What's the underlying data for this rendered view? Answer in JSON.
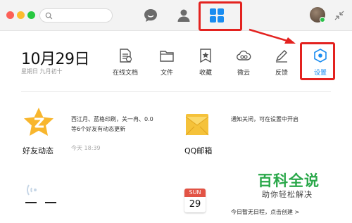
{
  "topbar": {
    "icons": [
      "search-icon",
      "chat-icon",
      "contacts-icon",
      "apps-grid-icon",
      "avatar",
      "collapse-icon"
    ],
    "accent": "#1a8cf0",
    "highlight_color": "#e3221f"
  },
  "header": {
    "date": "10月29日",
    "lunar": "星期日  九月初十"
  },
  "tools": [
    {
      "label": "在线文档",
      "icon": "online-doc-icon"
    },
    {
      "label": "文件",
      "icon": "folder-icon"
    },
    {
      "label": "收藏",
      "icon": "favorites-icon"
    },
    {
      "label": "微云",
      "icon": "cloud-icon"
    },
    {
      "label": "反馈",
      "icon": "feedback-pen-icon"
    },
    {
      "label": "设置",
      "icon": "settings-icon"
    }
  ],
  "cards": {
    "friends": {
      "title": "好友动态",
      "line1": "西江月、蓝格印刷，关一冉、0.0",
      "line2": "等6个好友有动态更新",
      "time": "今天 18:39"
    },
    "mail": {
      "title": "QQ邮箱",
      "text": "通知关闭，可在设置中开启"
    },
    "calendar": {
      "month": "SUN",
      "day": "29",
      "text": "今日暂无日程，点击创建 >"
    },
    "unknown": {
      "title": "— —"
    }
  },
  "watermark": {
    "title": "百科全说",
    "subtitle": "助你轻松解决"
  }
}
